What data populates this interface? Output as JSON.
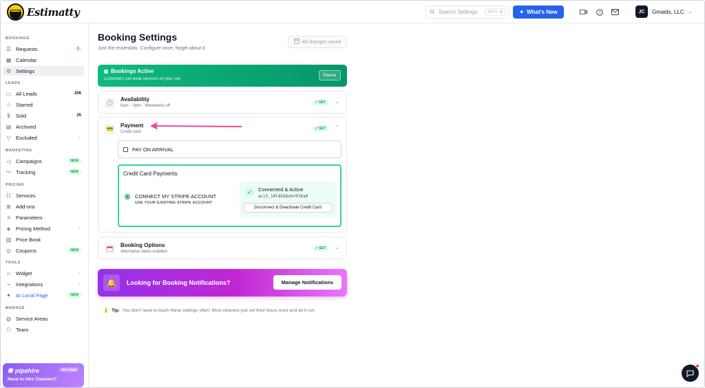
{
  "header": {
    "brand": "Estimatty",
    "search_placeholder": "Search Settings",
    "search_shortcut": "Ctrl K",
    "whats_new": "What's New",
    "account_initials": "JC",
    "account_name": "Gmaids, LLC"
  },
  "sidebar": {
    "sections": [
      {
        "title": "BOOKINGS",
        "items": [
          {
            "label": "Requests",
            "icon": "list-icon",
            "count": "1"
          },
          {
            "label": "Calendar",
            "icon": "calendar-icon"
          },
          {
            "label": "Settings",
            "icon": "gear-icon",
            "active": true
          }
        ]
      },
      {
        "title": "LEADS",
        "items": [
          {
            "label": "All Leads",
            "icon": "inbox-icon",
            "count": "206"
          },
          {
            "label": "Starred",
            "icon": "star-icon"
          },
          {
            "label": "Sold",
            "icon": "dollar-icon",
            "count": "25"
          },
          {
            "label": "Archived",
            "icon": "archive-icon"
          },
          {
            "label": "Excluded",
            "icon": "filter-icon",
            "chevron": true
          }
        ]
      },
      {
        "title": "MARKETING",
        "items": [
          {
            "label": "Campaigns",
            "icon": "megaphone-icon",
            "badge": "NEW"
          },
          {
            "label": "Tracking",
            "icon": "tracking-icon",
            "badge": "NEW"
          }
        ]
      },
      {
        "title": "PRICING",
        "items": [
          {
            "label": "Services",
            "icon": "services-icon"
          },
          {
            "label": "Add-ons",
            "icon": "addons-icon"
          },
          {
            "label": "Parameters",
            "icon": "sliders-icon"
          },
          {
            "label": "Pricing Method",
            "icon": "pricing-icon",
            "chevron": true
          },
          {
            "label": "Price Book",
            "icon": "book-icon"
          },
          {
            "label": "Coupons",
            "icon": "coupon-icon",
            "badge": "NEW"
          }
        ]
      },
      {
        "title": "TOOLS",
        "items": [
          {
            "label": "Widget",
            "icon": "code-icon",
            "chevron": true
          },
          {
            "label": "Integrations",
            "icon": "plug-icon",
            "chevron": true
          },
          {
            "label": "AI Local Page",
            "icon": "sparkle-icon",
            "badge": "NEW",
            "highlight": true
          }
        ]
      },
      {
        "title": "MANAGE",
        "items": [
          {
            "label": "Service Areas",
            "icon": "globe-icon"
          },
          {
            "label": "Team",
            "icon": "team-icon"
          }
        ]
      }
    ],
    "promo": {
      "brand": "pipehire",
      "tag": "TRY FREE",
      "text": "Need to Hire Cleaners?"
    }
  },
  "main": {
    "title": "Booking Settings",
    "subtitle": "Just the essentials. Configure once, forget about it.",
    "saved_status": "All changes saved",
    "active_banner": {
      "title": "Bookings Active",
      "subtitle": "Customers can book services on your site",
      "button": "Pause"
    },
    "availability": {
      "title": "Availability",
      "subtitle": "8am – 4pm · Weekends off",
      "badge": "✓ SET"
    },
    "payment": {
      "title": "Payment",
      "subtitle": "Credit card",
      "badge": "✓ SET",
      "pay_on_arrival": "PAY ON ARRIVAL",
      "cc_title": "Credit Card Payments",
      "connect_label": "CONNECT MY STRIPE ACCOUNT",
      "connect_sub": "USE YOUR EXISTING STRIPE ACCOUNT",
      "connected_title": "Connected & Active",
      "account_id": "acct_14l4CbGxhr0lKa0",
      "disconnect": "Disconnect & Deactivate Credit Card"
    },
    "booking_options": {
      "title": "Booking Options",
      "subtitle": "Alternative dates enabled",
      "badge": "✓ SET"
    },
    "notifications": {
      "text": "Looking for Booking Notifications?",
      "button": "Manage Notifications"
    },
    "tip": {
      "label": "Tip:",
      "text": "You don't need to touch these settings often. Most cleaners just set their hours once and let it run."
    }
  },
  "colors": {
    "primary_blue": "#2563eb",
    "active_green": "#10b981",
    "annotation_arrow": "#ec4899",
    "notification_purple": "#c026d3"
  }
}
